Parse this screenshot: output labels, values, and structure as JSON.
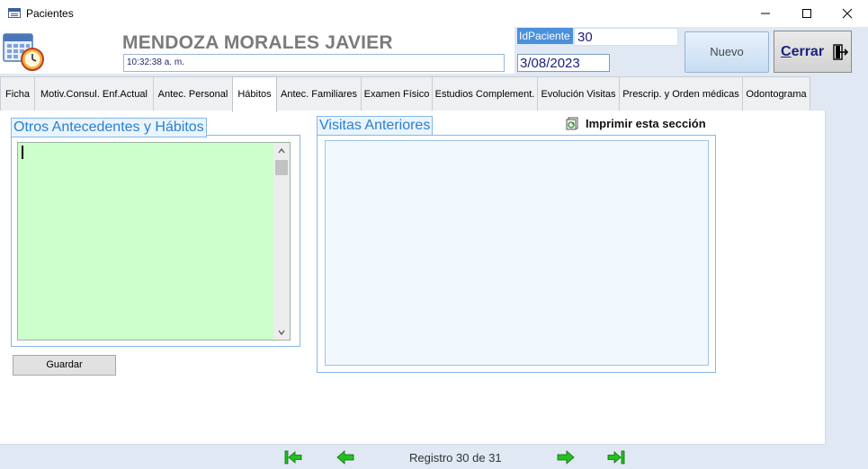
{
  "window": {
    "title": "Pacientes",
    "minimize_label": "—",
    "maximize_label": "☐",
    "close_label": "✕"
  },
  "patient": {
    "name": "MENDOZA MORALES JAVIER",
    "time": "10:32:38 a. m.",
    "id_label": "IdPaciente",
    "id_value": "30",
    "date": "3/08/2023"
  },
  "buttons": {
    "nuevo": "Nuevo",
    "cerrar_first": "C",
    "cerrar_rest": "errar",
    "guardar": "Guardar"
  },
  "tabs": [
    {
      "label": "Ficha"
    },
    {
      "label": "Motiv.Consul. Enf.Actual"
    },
    {
      "label": "Antec. Personal"
    },
    {
      "label": "Hábitos"
    },
    {
      "label": "Antec. Familiares"
    },
    {
      "label": "Examen Físico"
    },
    {
      "label": "Estudios Complement."
    },
    {
      "label": "Evolución Visitas"
    },
    {
      "label": "Prescrip. y Orden médicas"
    },
    {
      "label": "Odontograma"
    }
  ],
  "active_tab": "Hábitos",
  "sections": {
    "otros_label": "Otros Antecedentes y Hábitos",
    "otros_value": "",
    "visitas_label": "Visitas Anteriores",
    "print_label": "Imprimir esta sección"
  },
  "navigation": {
    "record_text": "Registro 30 de 31",
    "current": 30,
    "total": 31
  },
  "colors": {
    "accent": "#2a7fd0",
    "habitos_field": "#ccffcc",
    "nav_arrows": "#22c21e",
    "header_bg": "#dfe8f3"
  }
}
